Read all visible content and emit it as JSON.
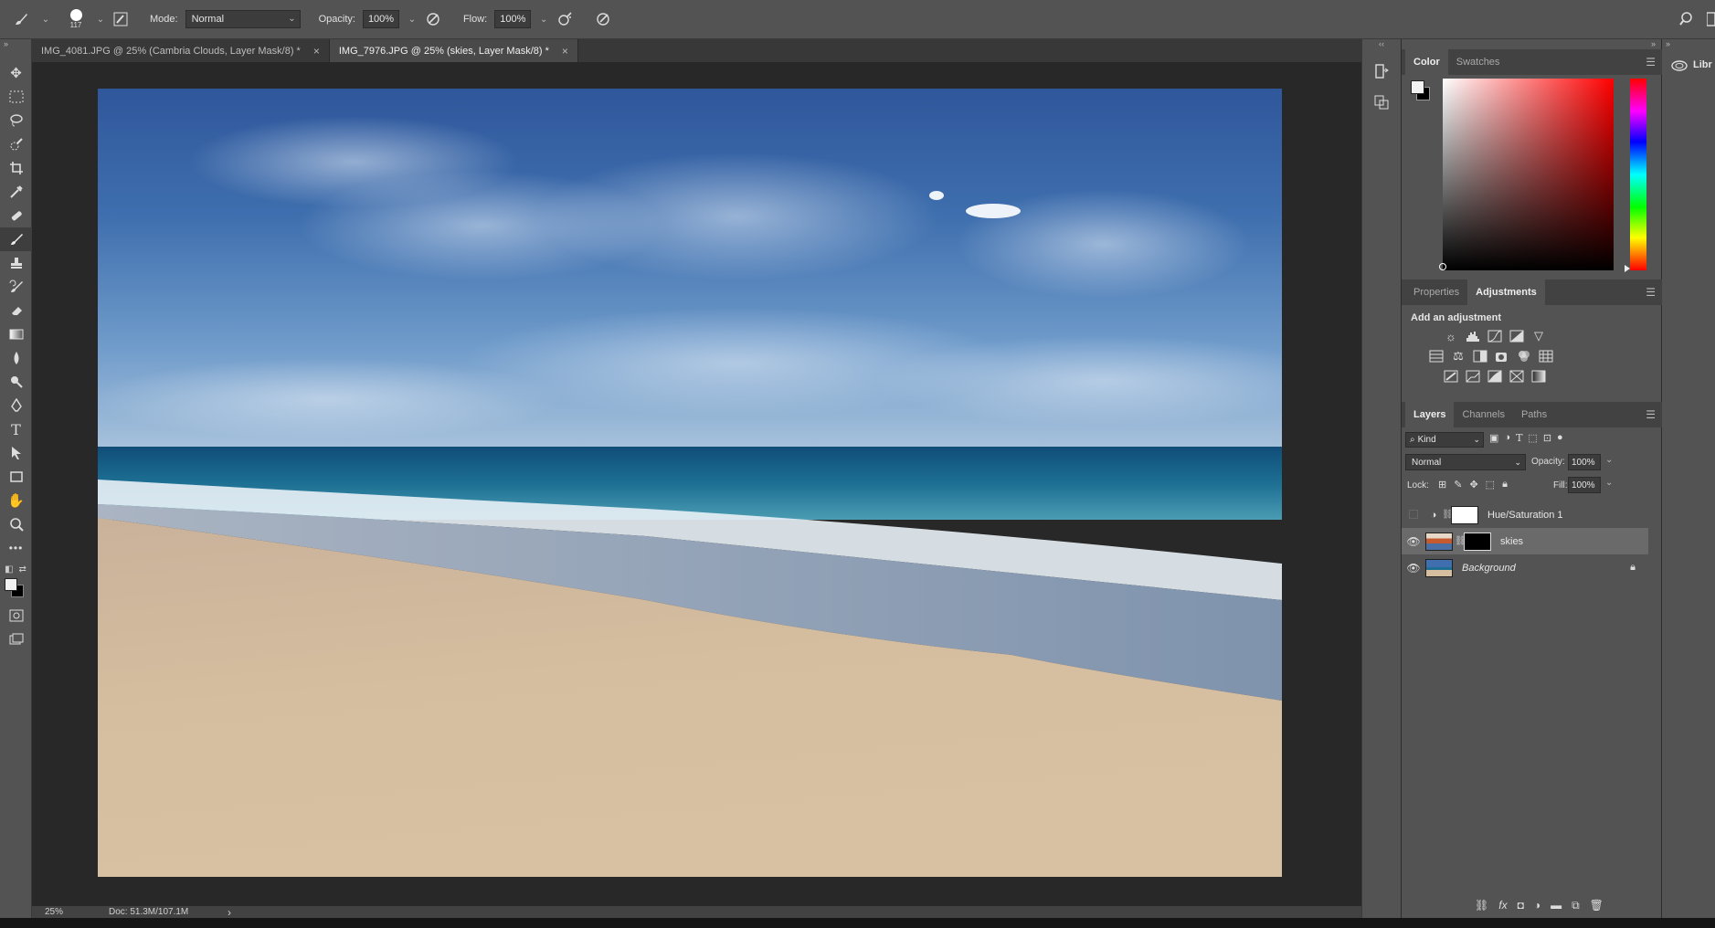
{
  "options_bar": {
    "brush_size": "117",
    "mode_label": "Mode:",
    "mode_value": "Normal",
    "opacity_label": "Opacity:",
    "opacity_value": "100%",
    "flow_label": "Flow:",
    "flow_value": "100%"
  },
  "tabs": [
    {
      "label": "IMG_4081.JPG @ 25% (Cambria Clouds, Layer Mask/8) *",
      "close": "×",
      "active": false
    },
    {
      "label": "IMG_7976.JPG @ 25% (skies, Layer Mask/8) *",
      "close": "×",
      "active": true
    }
  ],
  "status_bar": {
    "zoom": "25%",
    "doc_info": "Doc: 51.3M/107.1M",
    "arrow": "›"
  },
  "color_panel": {
    "tabs": [
      "Color",
      "Swatches"
    ],
    "active_tab": "Color",
    "foreground_color": "#f2f2f2",
    "background_color": "#000000",
    "hue_color": "#ff0000"
  },
  "adjustments_panel": {
    "tabs": [
      "Properties",
      "Adjustments"
    ],
    "active_tab": "Adjustments",
    "heading": "Add an adjustment",
    "rows": [
      [
        "brightness-contrast-icon",
        "levels-icon",
        "curves-icon",
        "exposure-icon",
        "vibrance-icon"
      ],
      [
        "hue-saturation-icon",
        "color-balance-icon",
        "black-white-icon",
        "photo-filter-icon",
        "channel-mixer-icon",
        "color-lookup-icon"
      ],
      [
        "invert-icon",
        "posterize-icon",
        "threshold-icon",
        "selective-color-icon",
        "gradient-map-icon"
      ]
    ]
  },
  "layers_panel": {
    "tabs": [
      "Layers",
      "Channels",
      "Paths"
    ],
    "active_tab": "Layers",
    "filter_kind": "Kind",
    "blend_mode": "Normal",
    "opacity_label": "Opacity:",
    "opacity_value": "100%",
    "lock_label": "Lock:",
    "fill_label": "Fill:",
    "fill_value": "100%",
    "layers": [
      {
        "name": "Hue/Saturation 1",
        "visible": false,
        "selected": false,
        "type": "adjustment"
      },
      {
        "name": "skies",
        "visible": true,
        "selected": true,
        "type": "masked"
      },
      {
        "name": "Background",
        "visible": true,
        "selected": false,
        "type": "background",
        "locked": true
      }
    ]
  },
  "libraries_label": "Libr"
}
